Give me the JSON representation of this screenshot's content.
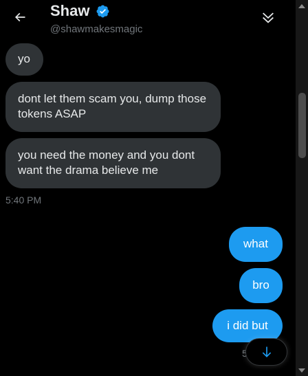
{
  "header": {
    "name": "Shaw",
    "handle": "@shawmakesmagic"
  },
  "messages": [
    {
      "direction": "in",
      "text": "yo"
    },
    {
      "direction": "in",
      "text": "dont let them scam you, dump those tokens ASAP"
    },
    {
      "direction": "in",
      "text": "you need the money and you dont want the drama believe me"
    },
    {
      "direction": "out",
      "text": "what"
    },
    {
      "direction": "out",
      "text": "bro"
    },
    {
      "direction": "out",
      "text": "i did but"
    }
  ],
  "timestamps": {
    "incoming": "5:40 PM",
    "outgoing": "5"
  },
  "icons": {
    "back": "arrow-left-icon",
    "verified": "verified-badge-icon",
    "collapse": "double-chevron-down-icon",
    "scroll_down": "arrow-down-icon"
  },
  "colors": {
    "background": "#000000",
    "incoming_bubble": "#2f3336",
    "outgoing_bubble": "#1d9bf0",
    "verified": "#1d9bf0",
    "muted_text": "#71767b"
  }
}
